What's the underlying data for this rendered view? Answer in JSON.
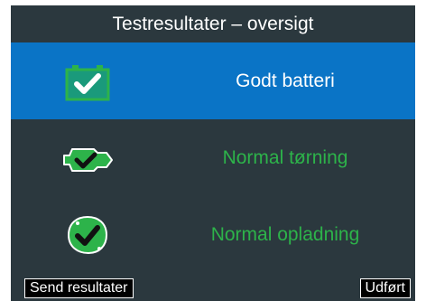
{
  "header": {
    "title": "Testresultater – oversigt"
  },
  "results": [
    {
      "label": "Godt batteri",
      "icon": "battery-check-icon",
      "selected": true
    },
    {
      "label": "Normal tørning",
      "icon": "starter-motor-check-icon",
      "selected": false
    },
    {
      "label": "Normal opladning",
      "icon": "alternator-check-icon",
      "selected": false
    }
  ],
  "softkeys": {
    "left_label": "Send resultater",
    "right_label": "Udført"
  },
  "colors": {
    "panel_bg": "#2b383e",
    "selected_bg": "#0a74c6",
    "ok_green": "#2db34a",
    "text_white": "#ffffff"
  }
}
